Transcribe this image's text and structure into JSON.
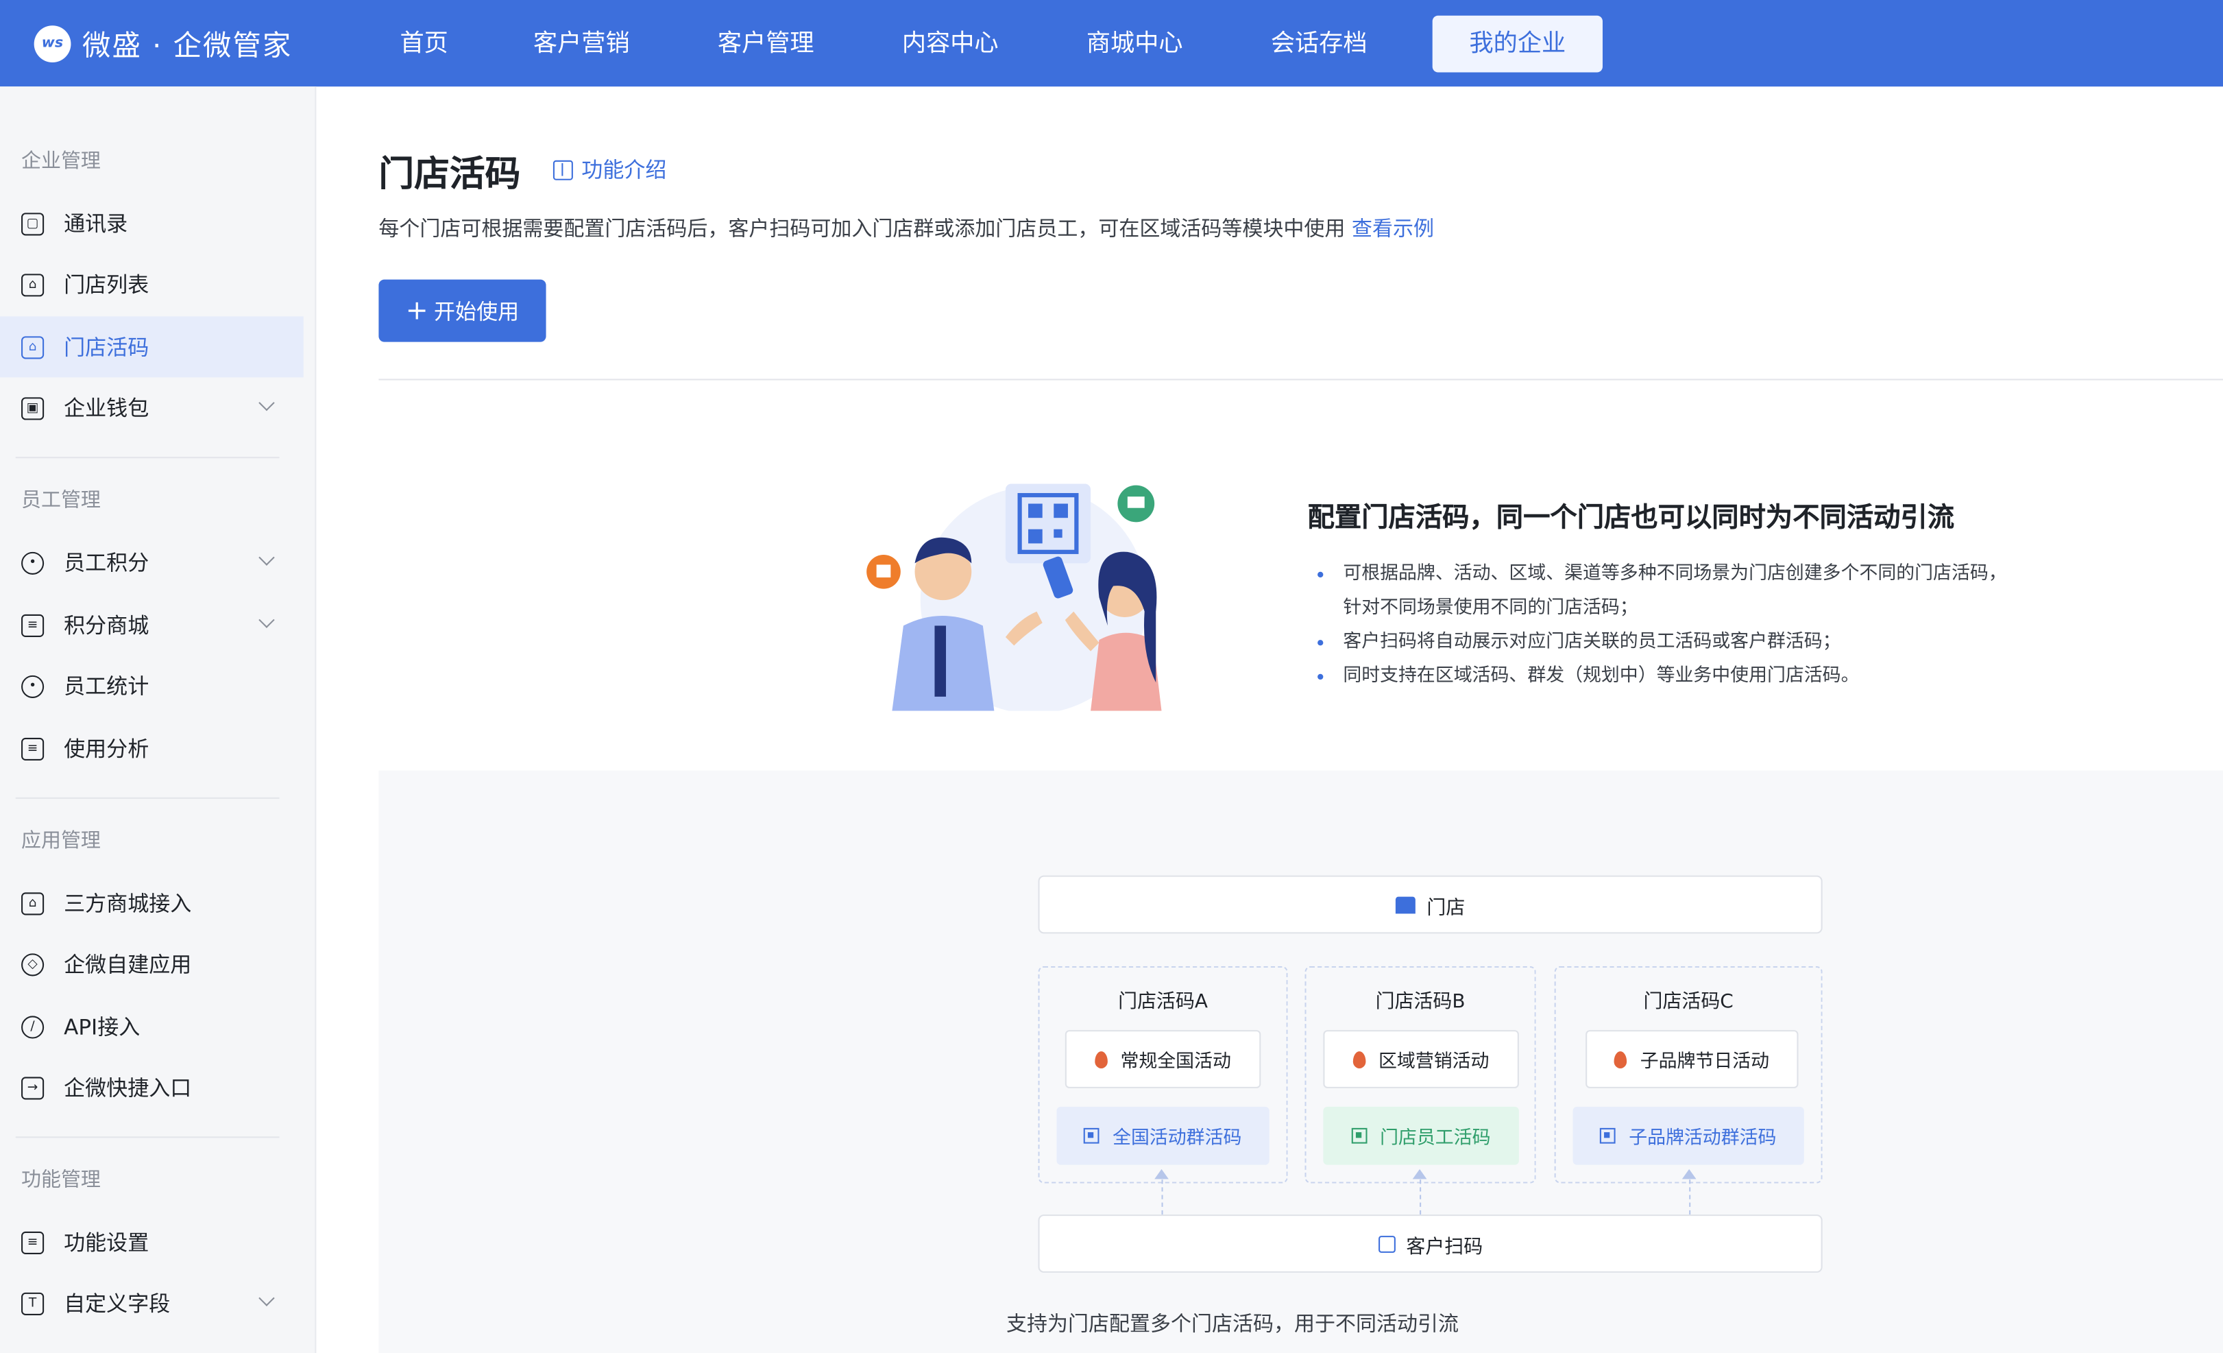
{
  "brand": {
    "logo_badge": "ws",
    "name": "微盛 · 企微管家"
  },
  "nav": [
    {
      "label": "首页"
    },
    {
      "label": "客户营销"
    },
    {
      "label": "客户管理"
    },
    {
      "label": "内容中心"
    },
    {
      "label": "商城中心"
    },
    {
      "label": "会话存档"
    },
    {
      "label": "我的企业",
      "active": true
    }
  ],
  "sidebar": {
    "groups": [
      {
        "title": "企业管理",
        "items": [
          {
            "label": "通讯录",
            "icon": "contacts-icon"
          },
          {
            "label": "门店列表",
            "icon": "store-list-icon"
          },
          {
            "label": "门店活码",
            "icon": "store-code-icon",
            "active": true
          },
          {
            "label": "企业钱包",
            "icon": "wallet-icon",
            "expandable": true
          }
        ]
      },
      {
        "title": "员工管理",
        "items": [
          {
            "label": "员工积分",
            "icon": "user-points-icon",
            "expandable": true
          },
          {
            "label": "积分商城",
            "icon": "points-mall-icon",
            "expandable": true
          },
          {
            "label": "员工统计",
            "icon": "user-stats-icon"
          },
          {
            "label": "使用分析",
            "icon": "analysis-icon"
          }
        ]
      },
      {
        "title": "应用管理",
        "items": [
          {
            "label": "三方商城接入",
            "icon": "mall-connect-icon"
          },
          {
            "label": "企微自建应用",
            "icon": "cube-icon"
          },
          {
            "label": "API接入",
            "icon": "api-icon"
          },
          {
            "label": "企微快捷入口",
            "icon": "shortcut-icon"
          }
        ]
      },
      {
        "title": "功能管理",
        "items": [
          {
            "label": "功能设置",
            "icon": "sliders-icon"
          },
          {
            "label": "自定义字段",
            "icon": "text-field-icon",
            "expandable": true
          }
        ]
      }
    ]
  },
  "main": {
    "title": "门店活码",
    "intro_link": "功能介绍",
    "description": "每个门店可根据需要配置门店活码后，客户扫码可加入门店群或添加门店员工，可在区域活码等模块中使用",
    "example_link": "查看示例",
    "start_button": "开始使用",
    "feature": {
      "title": "配置门店活码，同一个门店也可以同时为不同活动引流",
      "points": [
        "可根据品牌、活动、区域、渠道等多种不同场景为门店创建多个不同的门店活码，",
        "针对不同场景使用不同的门店活码；",
        "客户扫码将自动展示对应门店关联的员工活码或客户群活码；",
        "同时支持在区域活码、群发（规划中）等业务中使用门店活码。"
      ]
    },
    "diagram": {
      "store_label": "门店",
      "scan_label": "客户扫码",
      "columns": [
        {
          "title": "门店活码A",
          "activity": "常规全国活动",
          "code": "全国活动群活码"
        },
        {
          "title": "门店活码B",
          "activity": "区域营销活动",
          "code": "门店员工活码"
        },
        {
          "title": "门店活码C",
          "activity": "子品牌节日活动",
          "code": "子品牌活动群活码"
        }
      ],
      "caption": "支持为门店配置多个门店活码，用于不同活动引流"
    }
  },
  "colors": {
    "primary": "#3d6fdc",
    "green": "#2f9e6b",
    "flame": "#e2643a"
  }
}
